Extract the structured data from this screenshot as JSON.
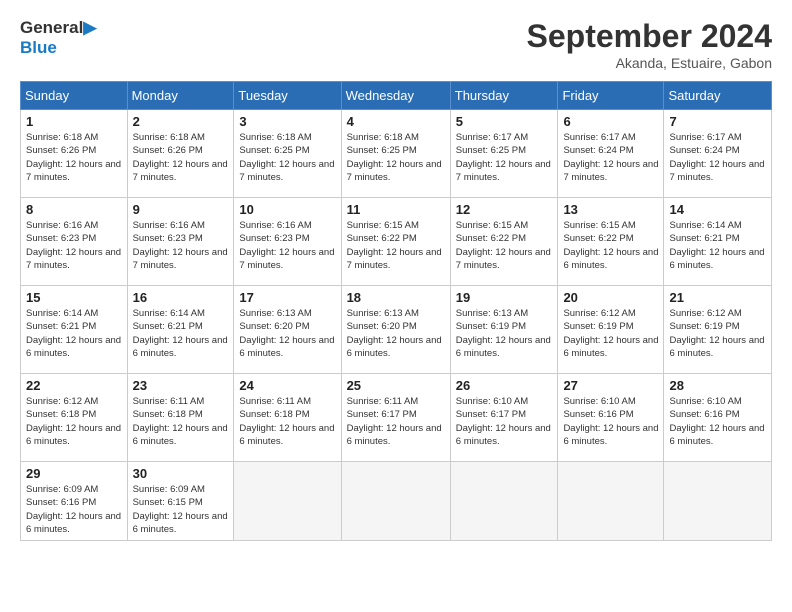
{
  "header": {
    "logo_line1": "General",
    "logo_line2": "Blue",
    "month_title": "September 2024",
    "location": "Akanda, Estuaire, Gabon"
  },
  "days_of_week": [
    "Sunday",
    "Monday",
    "Tuesday",
    "Wednesday",
    "Thursday",
    "Friday",
    "Saturday"
  ],
  "weeks": [
    [
      {
        "day": "1",
        "sunrise": "6:18 AM",
        "sunset": "6:26 PM",
        "daylight": "12 hours and 7 minutes."
      },
      {
        "day": "2",
        "sunrise": "6:18 AM",
        "sunset": "6:26 PM",
        "daylight": "12 hours and 7 minutes."
      },
      {
        "day": "3",
        "sunrise": "6:18 AM",
        "sunset": "6:25 PM",
        "daylight": "12 hours and 7 minutes."
      },
      {
        "day": "4",
        "sunrise": "6:18 AM",
        "sunset": "6:25 PM",
        "daylight": "12 hours and 7 minutes."
      },
      {
        "day": "5",
        "sunrise": "6:17 AM",
        "sunset": "6:25 PM",
        "daylight": "12 hours and 7 minutes."
      },
      {
        "day": "6",
        "sunrise": "6:17 AM",
        "sunset": "6:24 PM",
        "daylight": "12 hours and 7 minutes."
      },
      {
        "day": "7",
        "sunrise": "6:17 AM",
        "sunset": "6:24 PM",
        "daylight": "12 hours and 7 minutes."
      }
    ],
    [
      {
        "day": "8",
        "sunrise": "6:16 AM",
        "sunset": "6:23 PM",
        "daylight": "12 hours and 7 minutes."
      },
      {
        "day": "9",
        "sunrise": "6:16 AM",
        "sunset": "6:23 PM",
        "daylight": "12 hours and 7 minutes."
      },
      {
        "day": "10",
        "sunrise": "6:16 AM",
        "sunset": "6:23 PM",
        "daylight": "12 hours and 7 minutes."
      },
      {
        "day": "11",
        "sunrise": "6:15 AM",
        "sunset": "6:22 PM",
        "daylight": "12 hours and 7 minutes."
      },
      {
        "day": "12",
        "sunrise": "6:15 AM",
        "sunset": "6:22 PM",
        "daylight": "12 hours and 7 minutes."
      },
      {
        "day": "13",
        "sunrise": "6:15 AM",
        "sunset": "6:22 PM",
        "daylight": "12 hours and 6 minutes."
      },
      {
        "day": "14",
        "sunrise": "6:14 AM",
        "sunset": "6:21 PM",
        "daylight": "12 hours and 6 minutes."
      }
    ],
    [
      {
        "day": "15",
        "sunrise": "6:14 AM",
        "sunset": "6:21 PM",
        "daylight": "12 hours and 6 minutes."
      },
      {
        "day": "16",
        "sunrise": "6:14 AM",
        "sunset": "6:21 PM",
        "daylight": "12 hours and 6 minutes."
      },
      {
        "day": "17",
        "sunrise": "6:13 AM",
        "sunset": "6:20 PM",
        "daylight": "12 hours and 6 minutes."
      },
      {
        "day": "18",
        "sunrise": "6:13 AM",
        "sunset": "6:20 PM",
        "daylight": "12 hours and 6 minutes."
      },
      {
        "day": "19",
        "sunrise": "6:13 AM",
        "sunset": "6:19 PM",
        "daylight": "12 hours and 6 minutes."
      },
      {
        "day": "20",
        "sunrise": "6:12 AM",
        "sunset": "6:19 PM",
        "daylight": "12 hours and 6 minutes."
      },
      {
        "day": "21",
        "sunrise": "6:12 AM",
        "sunset": "6:19 PM",
        "daylight": "12 hours and 6 minutes."
      }
    ],
    [
      {
        "day": "22",
        "sunrise": "6:12 AM",
        "sunset": "6:18 PM",
        "daylight": "12 hours and 6 minutes."
      },
      {
        "day": "23",
        "sunrise": "6:11 AM",
        "sunset": "6:18 PM",
        "daylight": "12 hours and 6 minutes."
      },
      {
        "day": "24",
        "sunrise": "6:11 AM",
        "sunset": "6:18 PM",
        "daylight": "12 hours and 6 minutes."
      },
      {
        "day": "25",
        "sunrise": "6:11 AM",
        "sunset": "6:17 PM",
        "daylight": "12 hours and 6 minutes."
      },
      {
        "day": "26",
        "sunrise": "6:10 AM",
        "sunset": "6:17 PM",
        "daylight": "12 hours and 6 minutes."
      },
      {
        "day": "27",
        "sunrise": "6:10 AM",
        "sunset": "6:16 PM",
        "daylight": "12 hours and 6 minutes."
      },
      {
        "day": "28",
        "sunrise": "6:10 AM",
        "sunset": "6:16 PM",
        "daylight": "12 hours and 6 minutes."
      }
    ],
    [
      {
        "day": "29",
        "sunrise": "6:09 AM",
        "sunset": "6:16 PM",
        "daylight": "12 hours and 6 minutes."
      },
      {
        "day": "30",
        "sunrise": "6:09 AM",
        "sunset": "6:15 PM",
        "daylight": "12 hours and 6 minutes."
      },
      null,
      null,
      null,
      null,
      null
    ]
  ]
}
